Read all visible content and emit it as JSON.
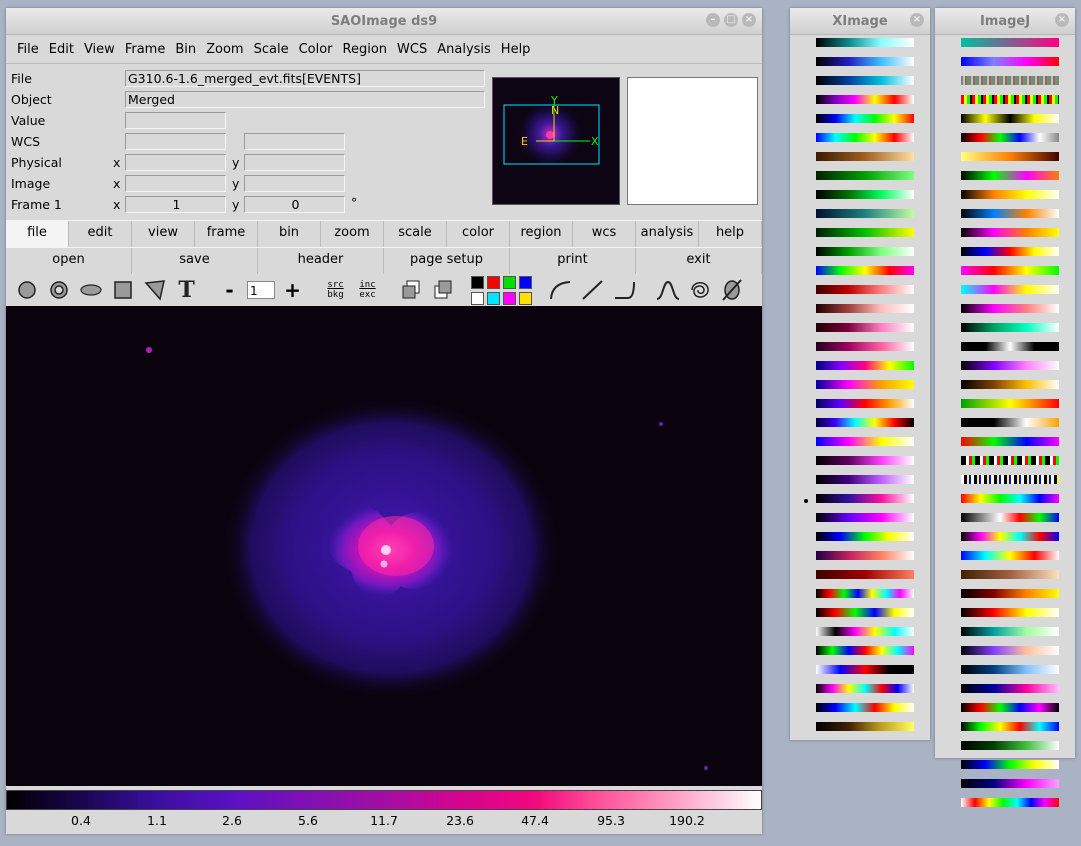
{
  "ds9": {
    "title": "SAOImage ds9",
    "menu": [
      "File",
      "Edit",
      "View",
      "Frame",
      "Bin",
      "Zoom",
      "Scale",
      "Color",
      "Region",
      "WCS",
      "Analysis",
      "Help"
    ],
    "info": {
      "file_label": "File",
      "file_value": "G310.6-1.6_merged_evt.fits[EVENTS]",
      "object_label": "Object",
      "object_value": "Merged",
      "value_label": "Value",
      "wcs_label": "WCS",
      "physical_label": "Physical",
      "image_label": "Image",
      "frame_label": "Frame 1",
      "x": "x",
      "y": "y",
      "frame_x": "1",
      "frame_y": "0",
      "degree": "°"
    },
    "panner": {
      "north": "N",
      "east": "E",
      "xaxis": "X",
      "yaxis": "Y"
    },
    "main_buttons": [
      "file",
      "edit",
      "view",
      "frame",
      "bin",
      "zoom",
      "scale",
      "color",
      "region",
      "wcs",
      "analysis",
      "help"
    ],
    "active_button": "file",
    "file_buttons": [
      "open",
      "save",
      "header",
      "page setup",
      "print",
      "exit"
    ],
    "toolbar": {
      "minus": "-",
      "width": "1",
      "plus": "+",
      "src": "src",
      "bkg": "bkg",
      "inc": "inc",
      "exc": "exc",
      "text_tool": "T"
    },
    "swatches": [
      "#000000",
      "#ff0000",
      "#00e000",
      "#0000ff",
      "#ffffff",
      "#00e5ff",
      "#ff00ff",
      "#ffe000"
    ],
    "colorbar_ticks": [
      "0.4",
      "1.1",
      "2.6",
      "5.6",
      "11.7",
      "23.6",
      "47.4",
      "95.3",
      "190.2"
    ]
  },
  "ximage": {
    "title": "XImage"
  },
  "imagej": {
    "title": "ImageJ"
  },
  "colors": {
    "accent": "#00e5ff",
    "panner_axes": "#00ff00",
    "panner_labels": "#ffd000"
  }
}
